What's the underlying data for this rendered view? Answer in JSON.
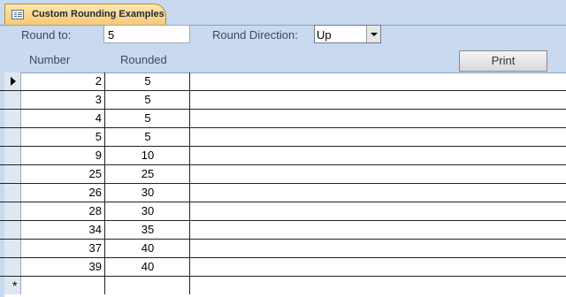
{
  "tab": {
    "title": "Custom Rounding Examples",
    "icon": "form-icon"
  },
  "controls": {
    "round_to_label": "Round to:",
    "round_to_value": "5",
    "direction_label": "Round Direction:",
    "direction_value": "Up",
    "print_label": "Print"
  },
  "columns": {
    "number": "Number",
    "rounded": "Rounded"
  },
  "rows": [
    {
      "number": "2",
      "rounded": "5"
    },
    {
      "number": "3",
      "rounded": "5"
    },
    {
      "number": "4",
      "rounded": "5"
    },
    {
      "number": "5",
      "rounded": "5"
    },
    {
      "number": "9",
      "rounded": "10"
    },
    {
      "number": "25",
      "rounded": "25"
    },
    {
      "number": "26",
      "rounded": "30"
    },
    {
      "number": "28",
      "rounded": "30"
    },
    {
      "number": "34",
      "rounded": "35"
    },
    {
      "number": "37",
      "rounded": "40"
    },
    {
      "number": "39",
      "rounded": "40"
    }
  ],
  "new_row_marker": "*",
  "icons": {
    "current_record": "current-record-icon",
    "new_record": "new-record-icon",
    "dropdown": "chevron-down-icon"
  }
}
